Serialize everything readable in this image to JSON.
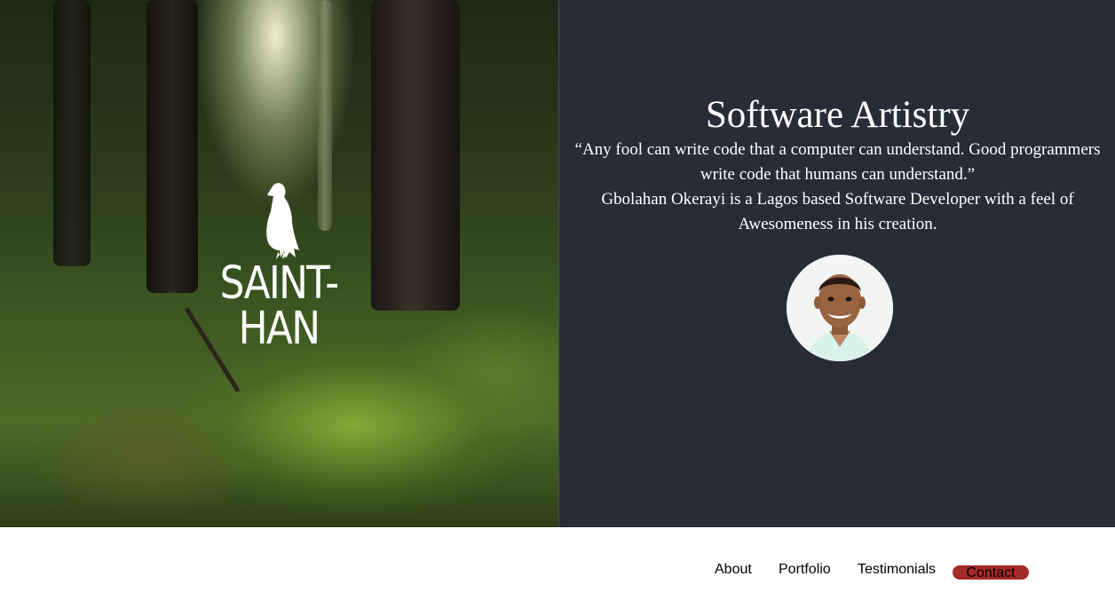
{
  "hero": {
    "brand_name": "SAINT-HAN",
    "logo_icon": "raven-icon"
  },
  "intro": {
    "headline": "Software Artistry",
    "quote": "“Any fool can write code that a computer can understand. Good programmers write code that humans can understand.”",
    "bio": "Gbolahan Okerayi is a Lagos based Software Developer with a feel of Awesomeness in his creation."
  },
  "nav": {
    "items": [
      {
        "label": "About"
      },
      {
        "label": "Portfolio"
      },
      {
        "label": "Testimonials"
      },
      {
        "label": "Contact"
      }
    ]
  },
  "colors": {
    "panel_bg": "#292c37",
    "contact_accent": "#a52a2a",
    "text_light": "#ffffff"
  }
}
